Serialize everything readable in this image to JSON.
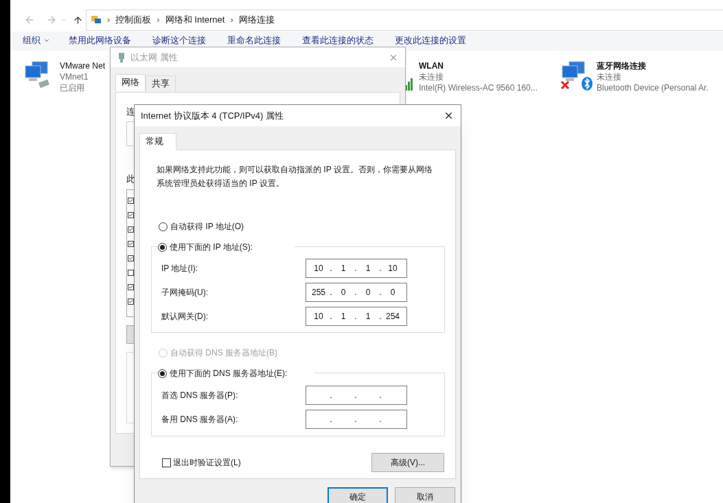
{
  "explorer": {
    "breadcrumb_separator": "›",
    "breadcrumb": [
      "控制面板",
      "网络和 Internet",
      "网络连接"
    ],
    "toolbar": [
      {
        "label": "组织",
        "kind": "menu"
      },
      {
        "label": "禁用此网络设备",
        "kind": "command"
      },
      {
        "label": "诊断这个连接",
        "kind": "command"
      },
      {
        "label": "重命名此连接",
        "kind": "command"
      },
      {
        "label": "查看此连接的状态",
        "kind": "command"
      },
      {
        "label": "更改此连接的设置",
        "kind": "command"
      }
    ],
    "connections": [
      {
        "kind": "wired",
        "lines": [
          "VMware Net",
          "VMnet1",
          "已启用"
        ]
      },
      {
        "kind": "wifi",
        "lines": [
          "WLAN",
          "未连接",
          "Intel(R) Wireless-AC 9560 160..."
        ]
      },
      {
        "kind": "bluetooth",
        "lines": [
          "蓝牙网络连接",
          "未连接",
          "Bluetooth Device (Personal Ar."
        ]
      }
    ]
  },
  "ethernet_dialog": {
    "title": "以太网 属性",
    "tabs": [
      {
        "label": "网络",
        "selected": true
      },
      {
        "label": "共享",
        "selected": false
      }
    ],
    "label_1": "连",
    "label_2": "此",
    "components": [
      {
        "checked": true
      },
      {
        "checked": true
      },
      {
        "checked": true
      },
      {
        "checked": true
      },
      {
        "checked": true
      },
      {
        "checked": false
      },
      {
        "checked": true
      },
      {
        "checked": true
      }
    ]
  },
  "ipv4_dialog": {
    "title": "Internet 协议版本 4 (TCP/IPv4) 属性",
    "tabs": [
      {
        "label": "常规",
        "selected": true
      }
    ],
    "description": "如果网络支持此功能，则可以获取自动指派的 IP 设置。否则，你需要从网络系统管理员处获得适当的 IP 设置。",
    "separator": ".",
    "ip_options": [
      {
        "label": "自动获得 IP 地址(O)",
        "selected": false
      },
      {
        "label": "使用下面的 IP 地址(S):",
        "selected": true
      }
    ],
    "ip_fields": [
      {
        "label": "IP 地址(I):",
        "octets": [
          "10",
          "1",
          "1",
          "10"
        ]
      },
      {
        "label": "子网掩码(U):",
        "octets": [
          "255",
          "0",
          "0",
          "0"
        ]
      },
      {
        "label": "默认网关(D):",
        "octets": [
          "10",
          "1",
          "1",
          "254"
        ]
      }
    ],
    "dns_options": [
      {
        "label": "自动获得 DNS 服务器地址(B)",
        "selected": false,
        "disabled": true
      },
      {
        "label": "使用下面的 DNS 服务器地址(E):",
        "selected": true,
        "disabled": false
      }
    ],
    "dns_fields": [
      {
        "label": "首选 DNS 服务器(P):"
      },
      {
        "label": "备用 DNS 服务器(A):"
      }
    ],
    "validate": {
      "label": "退出时验证设置(L)",
      "checked": false
    },
    "advanced_button": "高级(V)...",
    "buttons": [
      {
        "label": "确定",
        "kind": "default"
      },
      {
        "label": "取消",
        "kind": "normal"
      }
    ]
  }
}
